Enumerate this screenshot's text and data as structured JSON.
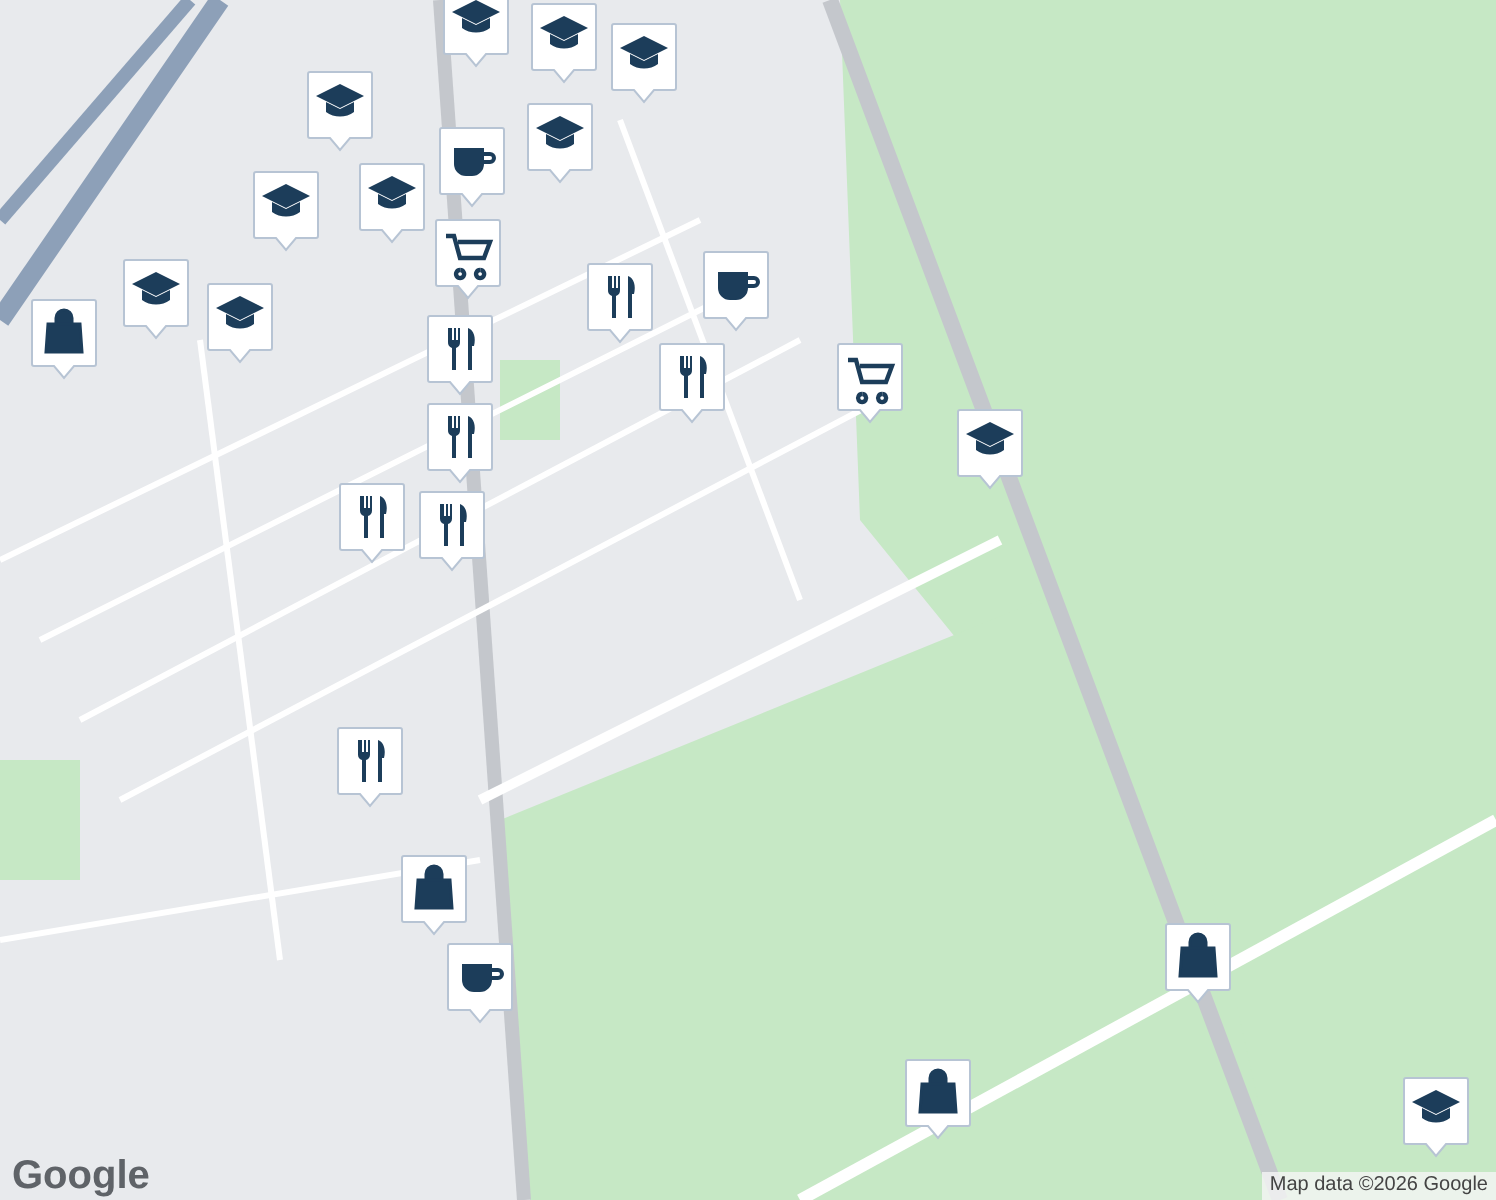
{
  "map": {
    "logo": "Google",
    "attribution": "Map data ©2026 Google"
  }
}
